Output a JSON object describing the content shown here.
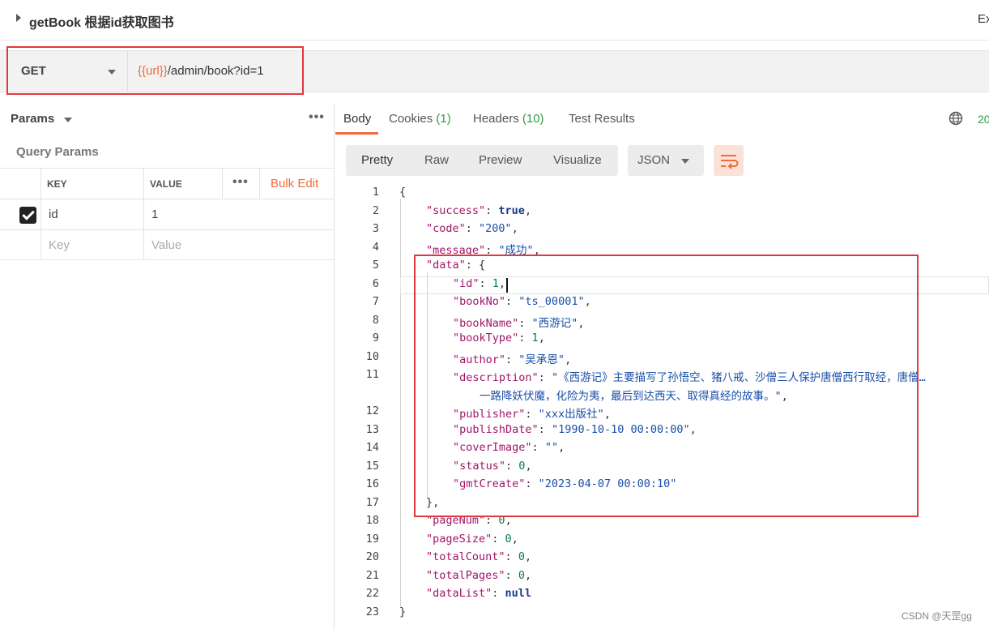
{
  "title": {
    "text": "getBook 根据id获取图书",
    "right_text": "Ex"
  },
  "request": {
    "method": "GET",
    "url_var": "{{url}}",
    "url_path": "/admin/book?id=1"
  },
  "left": {
    "section_label": "Params",
    "query_params_label": "Query Params",
    "columns": {
      "key": "KEY",
      "value": "VALUE",
      "bulk_edit": "Bulk Edit"
    },
    "rows": [
      {
        "checked": true,
        "key": "id",
        "value": "1"
      }
    ],
    "placeholder": {
      "key": "Key",
      "value": "Value"
    }
  },
  "response": {
    "tabs": [
      {
        "label": "Body",
        "count": ""
      },
      {
        "label": "Cookies",
        "count": "(1)"
      },
      {
        "label": "Headers",
        "count": "(10)"
      },
      {
        "label": "Test Results",
        "count": ""
      }
    ],
    "status_code": "20",
    "format_tabs": [
      "Pretty",
      "Raw",
      "Preview",
      "Visualize"
    ],
    "format_select": "JSON",
    "code_lines": [
      {
        "n": "1",
        "indent": 0,
        "tokens": [
          [
            "p",
            "{"
          ]
        ]
      },
      {
        "n": "2",
        "indent": 1,
        "tokens": [
          [
            "k",
            "\"success\""
          ],
          [
            "p",
            ": "
          ],
          [
            "b",
            "true"
          ],
          [
            "p",
            ","
          ]
        ]
      },
      {
        "n": "3",
        "indent": 1,
        "tokens": [
          [
            "k",
            "\"code\""
          ],
          [
            "p",
            ": "
          ],
          [
            "s",
            "\"200\""
          ],
          [
            "p",
            ","
          ]
        ]
      },
      {
        "n": "4",
        "indent": 1,
        "tokens": [
          [
            "k",
            "\"message\""
          ],
          [
            "p",
            ": "
          ],
          [
            "s",
            "\"成功\""
          ],
          [
            "p",
            ","
          ]
        ]
      },
      {
        "n": "5",
        "indent": 1,
        "tokens": [
          [
            "k",
            "\"data\""
          ],
          [
            "p",
            ": {"
          ]
        ]
      },
      {
        "n": "6",
        "indent": 2,
        "tokens": [
          [
            "k",
            "\"id\""
          ],
          [
            "p",
            ": "
          ],
          [
            "n",
            "1"
          ],
          [
            "p",
            ","
          ]
        ]
      },
      {
        "n": "7",
        "indent": 2,
        "tokens": [
          [
            "k",
            "\"bookNo\""
          ],
          [
            "p",
            ": "
          ],
          [
            "s",
            "\"ts_00001\""
          ],
          [
            "p",
            ","
          ]
        ]
      },
      {
        "n": "8",
        "indent": 2,
        "tokens": [
          [
            "k",
            "\"bookName\""
          ],
          [
            "p",
            ": "
          ],
          [
            "s",
            "\"西游记\""
          ],
          [
            "p",
            ","
          ]
        ]
      },
      {
        "n": "9",
        "indent": 2,
        "tokens": [
          [
            "k",
            "\"bookType\""
          ],
          [
            "p",
            ": "
          ],
          [
            "n",
            "1"
          ],
          [
            "p",
            ","
          ]
        ]
      },
      {
        "n": "10",
        "indent": 2,
        "tokens": [
          [
            "k",
            "\"author\""
          ],
          [
            "p",
            ": "
          ],
          [
            "s",
            "\"吴承恩\""
          ],
          [
            "p",
            ","
          ]
        ]
      },
      {
        "n": "11",
        "indent": 2,
        "tokens": [
          [
            "k",
            "\"description\""
          ],
          [
            "p",
            ": "
          ],
          [
            "s",
            "\"《西游记》主要描写了孙悟空、猪八戒、沙僧三人保护唐僧西行取经，唐僧…"
          ]
        ]
      },
      {
        "n": "",
        "indent": 3,
        "tokens": [
          [
            "s",
            "一路降妖伏魔，化险为夷，最后到达西天、取得真经的故事。\""
          ],
          [
            "p",
            ","
          ]
        ]
      },
      {
        "n": "12",
        "indent": 2,
        "tokens": [
          [
            "k",
            "\"publisher\""
          ],
          [
            "p",
            ": "
          ],
          [
            "s",
            "\"xxx出版社\""
          ],
          [
            "p",
            ","
          ]
        ]
      },
      {
        "n": "13",
        "indent": 2,
        "tokens": [
          [
            "k",
            "\"publishDate\""
          ],
          [
            "p",
            ": "
          ],
          [
            "s",
            "\"1990-10-10 00:00:00\""
          ],
          [
            "p",
            ","
          ]
        ]
      },
      {
        "n": "14",
        "indent": 2,
        "tokens": [
          [
            "k",
            "\"coverImage\""
          ],
          [
            "p",
            ": "
          ],
          [
            "s",
            "\"\""
          ],
          [
            "p",
            ","
          ]
        ]
      },
      {
        "n": "15",
        "indent": 2,
        "tokens": [
          [
            "k",
            "\"status\""
          ],
          [
            "p",
            ": "
          ],
          [
            "n",
            "0"
          ],
          [
            "p",
            ","
          ]
        ]
      },
      {
        "n": "16",
        "indent": 2,
        "tokens": [
          [
            "k",
            "\"gmtCreate\""
          ],
          [
            "p",
            ": "
          ],
          [
            "s",
            "\"2023-04-07 00:00:10\""
          ]
        ]
      },
      {
        "n": "17",
        "indent": 1,
        "tokens": [
          [
            "p",
            "},"
          ]
        ]
      },
      {
        "n": "18",
        "indent": 1,
        "tokens": [
          [
            "k",
            "\"pageNum\""
          ],
          [
            "p",
            ": "
          ],
          [
            "n",
            "0"
          ],
          [
            "p",
            ","
          ]
        ]
      },
      {
        "n": "19",
        "indent": 1,
        "tokens": [
          [
            "k",
            "\"pageSize\""
          ],
          [
            "p",
            ": "
          ],
          [
            "n",
            "0"
          ],
          [
            "p",
            ","
          ]
        ]
      },
      {
        "n": "20",
        "indent": 1,
        "tokens": [
          [
            "k",
            "\"totalCount\""
          ],
          [
            "p",
            ": "
          ],
          [
            "n",
            "0"
          ],
          [
            "p",
            ","
          ]
        ]
      },
      {
        "n": "21",
        "indent": 1,
        "tokens": [
          [
            "k",
            "\"totalPages\""
          ],
          [
            "p",
            ": "
          ],
          [
            "n",
            "0"
          ],
          [
            "p",
            ","
          ]
        ]
      },
      {
        "n": "22",
        "indent": 1,
        "tokens": [
          [
            "k",
            "\"dataList\""
          ],
          [
            "p",
            ": "
          ],
          [
            "b",
            "null"
          ]
        ]
      },
      {
        "n": "23",
        "indent": 0,
        "tokens": [
          [
            "p",
            "}"
          ]
        ]
      }
    ]
  },
  "watermark": "CSDN @天罡gg",
  "colors": {
    "accent": "#f26b3a",
    "highlight_box": "#e0383e",
    "count_green": "#2f9e44"
  }
}
